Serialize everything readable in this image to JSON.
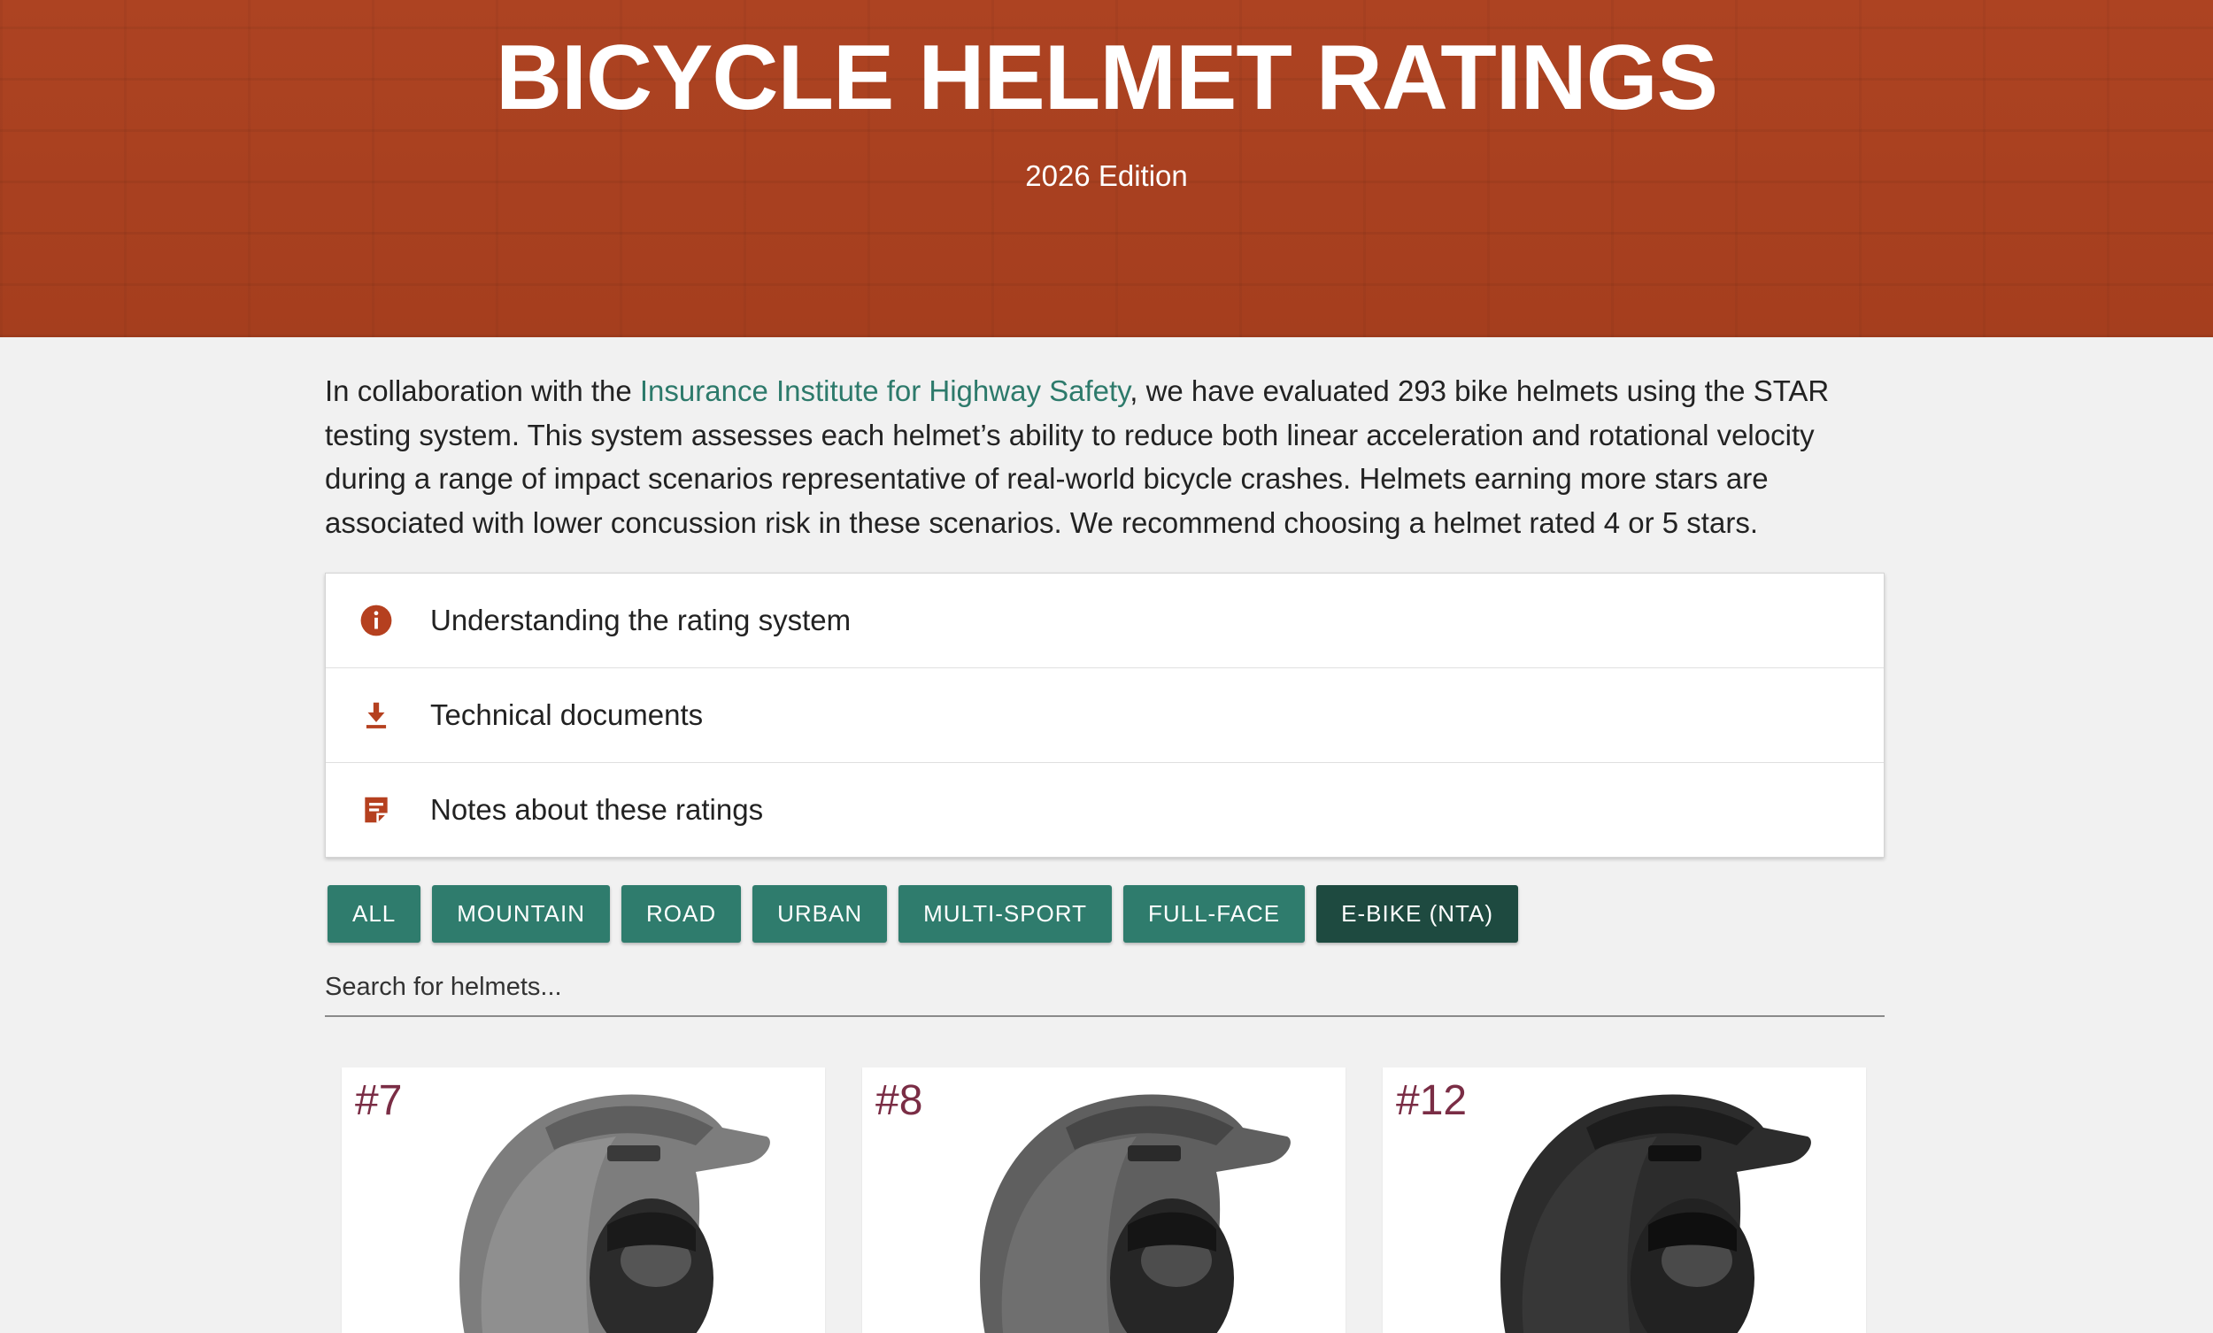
{
  "header": {
    "title": "BICYCLE HELMET RATINGS",
    "edition": "2026 Edition"
  },
  "intro": {
    "before_link": "In collaboration with the ",
    "link_text": "Insurance Institute for Highway Safety",
    "after_link": ", we have evaluated 293 bike helmets using the STAR testing system. This system assesses each helmet’s ability to reduce both linear acceleration and rotational velocity during a range of impact scenarios representative of real-world bicycle crashes. Helmets earning more stars are associated with lower concussion risk in these scenarios. We recommend choosing a helmet rated 4 or 5 stars."
  },
  "accordion": [
    {
      "label": "Understanding the rating system",
      "icon": "info-icon"
    },
    {
      "label": "Technical documents",
      "icon": "download-icon"
    },
    {
      "label": "Notes about these ratings",
      "icon": "note-icon"
    }
  ],
  "filters": [
    "ALL",
    "MOUNTAIN",
    "ROAD",
    "URBAN",
    "MULTI-SPORT",
    "FULL-FACE",
    "E-BIKE (NTA)"
  ],
  "active_filter": "E-BIKE (NTA)",
  "search": {
    "placeholder": "Search for helmets..."
  },
  "cards": [
    {
      "rank": "#7",
      "shade": "gray"
    },
    {
      "rank": "#8",
      "shade": "darkgray"
    },
    {
      "rank": "#12",
      "shade": "black"
    }
  ],
  "colors": {
    "hero": "#a8401f",
    "accent_icon": "#b5401f",
    "link": "#2d7a6b",
    "button": "#2f7c6d",
    "button_active": "#1e4a40",
    "rank": "#7a2d45"
  }
}
